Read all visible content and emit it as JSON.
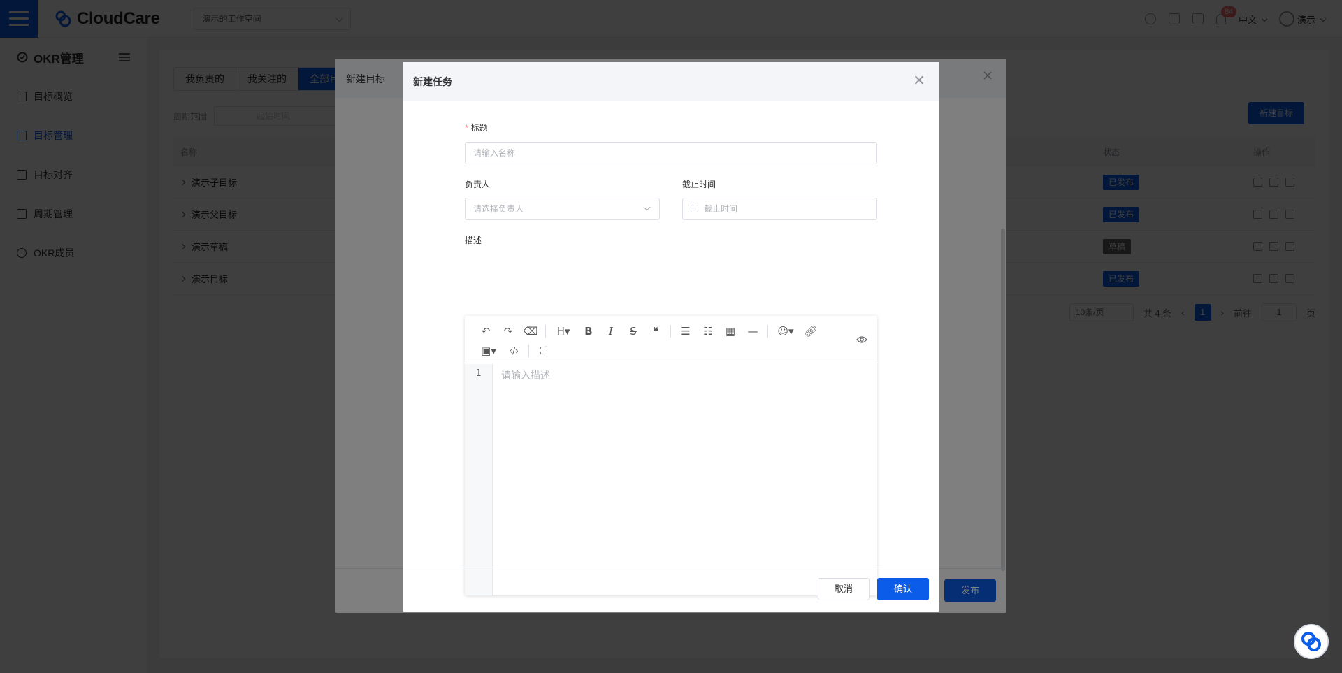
{
  "app": {
    "brand": "CloudCare"
  },
  "header": {
    "workspace": "演示的工作空间",
    "notification_count": "84",
    "language": "中文",
    "user_name": "演示"
  },
  "sidebar": {
    "title": "OKR管理",
    "items": [
      {
        "label": "目标概览",
        "icon": "overview-icon",
        "active": false
      },
      {
        "label": "目标管理",
        "icon": "list-icon",
        "active": true
      },
      {
        "label": "目标对齐",
        "icon": "align-icon",
        "active": false
      },
      {
        "label": "周期管理",
        "icon": "calendar-icon",
        "active": false
      },
      {
        "label": "OKR成员",
        "icon": "user-icon",
        "active": false
      }
    ]
  },
  "main": {
    "tabs": [
      "我负责的",
      "我关注的",
      "全部目"
    ],
    "filter_label": "周期范围",
    "filter_placeholder": "起始时间",
    "new_goal_button": "新建目标",
    "columns": {
      "name": "名称",
      "status": "状态",
      "ops": "操作"
    },
    "rows": [
      {
        "name": "演示子目标",
        "status": "已发布"
      },
      {
        "name": "演示父目标",
        "status": "已发布"
      },
      {
        "name": "演示草稿",
        "status": "草稿"
      },
      {
        "name": "演示目标",
        "status": "已发布"
      }
    ],
    "pager": {
      "page_size": "10条/页",
      "total": "共 4 条",
      "current_page": "1",
      "goto_label": "前往",
      "goto_value": "1",
      "page_suffix": "页"
    }
  },
  "goal_dialog": {
    "title": "新建目标",
    "publish_button": "发布"
  },
  "task_dialog": {
    "title": "新建任务",
    "title_label": "标题",
    "title_placeholder": "请输入名称",
    "owner_label": "负责人",
    "owner_placeholder": "请选择负责人",
    "deadline_label": "截止时间",
    "deadline_placeholder": "截止时间",
    "desc_label": "描述",
    "desc_placeholder": "请输入描述",
    "line_number": "1",
    "cancel_button": "取消",
    "confirm_button": "确认"
  },
  "colors": {
    "primary": "#0b5ce8",
    "danger": "#f56c6c",
    "overlay": "rgba(0,0,0,0.5)"
  }
}
